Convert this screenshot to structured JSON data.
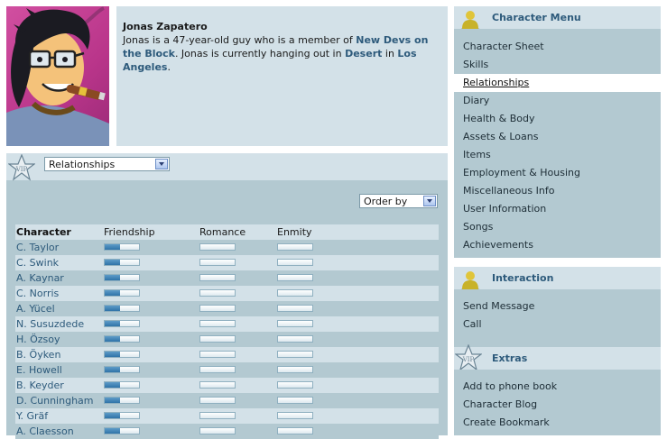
{
  "profile": {
    "name": "Jonas Zapatero",
    "desc_pre": "Jonas is a 47-year-old guy who is a member of ",
    "group_link": "New Devs on the Block",
    "desc_mid": ". Jonas is currently hanging out in ",
    "place_link": "Desert",
    "desc_in": " in ",
    "city_link": "Los Angeles",
    "desc_end": "."
  },
  "panel": {
    "view_select": "Relationships",
    "order_select": "Order by"
  },
  "table": {
    "headers": {
      "character": "Character",
      "friendship": "Friendship",
      "romance": "Romance",
      "enmity": "Enmity"
    },
    "rows": [
      {
        "name": "C. Taylor",
        "friendship": 0.45,
        "romance": 0,
        "enmity": 0
      },
      {
        "name": "C. Swink",
        "friendship": 0.45,
        "romance": 0,
        "enmity": 0
      },
      {
        "name": "A. Kaynar",
        "friendship": 0.45,
        "romance": 0,
        "enmity": 0
      },
      {
        "name": "C. Norris",
        "friendship": 0.45,
        "romance": 0,
        "enmity": 0
      },
      {
        "name": "A. Yücel",
        "friendship": 0.45,
        "romance": 0,
        "enmity": 0
      },
      {
        "name": "N. Susuzdede",
        "friendship": 0.45,
        "romance": 0,
        "enmity": 0
      },
      {
        "name": "H. Özsoy",
        "friendship": 0.45,
        "romance": 0,
        "enmity": 0
      },
      {
        "name": "B. Öyken",
        "friendship": 0.45,
        "romance": 0,
        "enmity": 0
      },
      {
        "name": "E. Howell",
        "friendship": 0.45,
        "romance": 0,
        "enmity": 0
      },
      {
        "name": "B. Keyder",
        "friendship": 0.45,
        "romance": 0,
        "enmity": 0
      },
      {
        "name": "D. Cunningham",
        "friendship": 0.45,
        "romance": 0,
        "enmity": 0
      },
      {
        "name": "Y. Gräf",
        "friendship": 0.45,
        "romance": 0,
        "enmity": 0
      },
      {
        "name": "A. Claesson",
        "friendship": 0.45,
        "romance": 0,
        "enmity": 0
      }
    ]
  },
  "sidebar": {
    "character_menu": {
      "title": "Character Menu",
      "items": [
        "Character Sheet",
        "Skills",
        "Relationships",
        "Diary",
        "Health & Body",
        "Assets & Loans",
        "Items",
        "Employment & Housing",
        "Miscellaneous Info",
        "User Information",
        "Songs",
        "Achievements"
      ],
      "active_index": 2
    },
    "interaction": {
      "title": "Interaction",
      "items": [
        "Send Message",
        "Call"
      ]
    },
    "extras": {
      "title": "Extras",
      "items": [
        "Add to phone book",
        "Character Blog",
        "Create Bookmark"
      ]
    }
  },
  "colors": {
    "panel_light": "#d3e1e8",
    "panel_dark": "#b3c9d1",
    "link": "#2d5a7b",
    "avatar_bg": "#c0408f"
  }
}
